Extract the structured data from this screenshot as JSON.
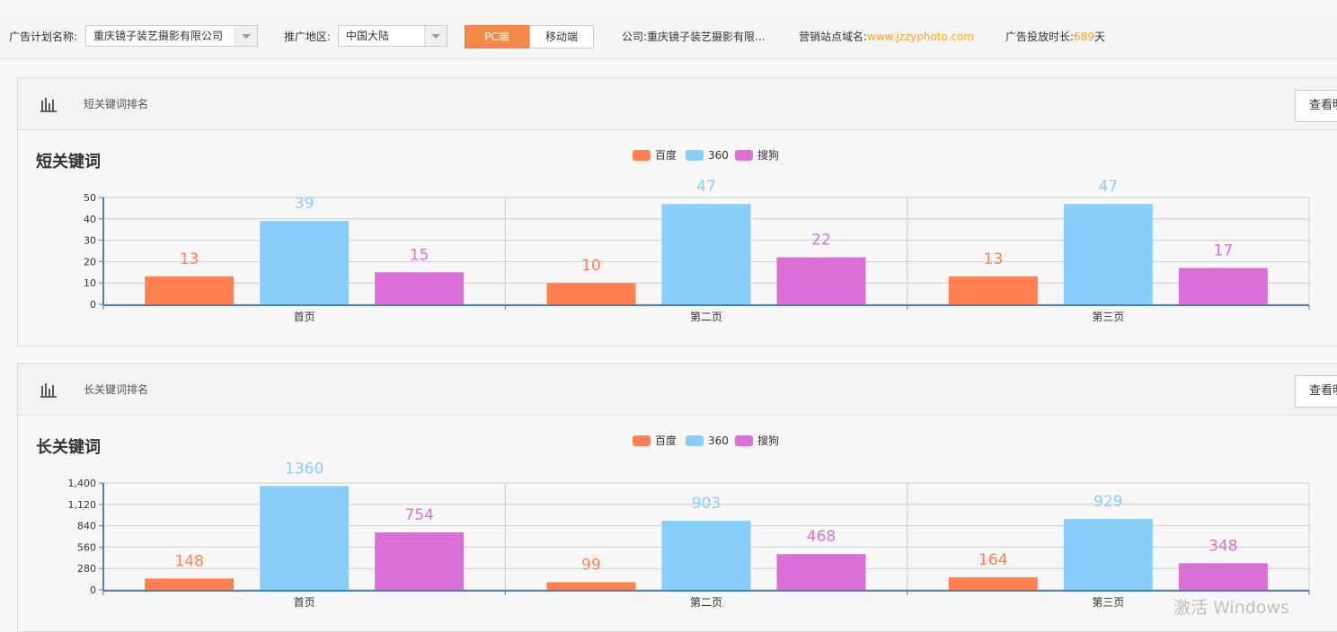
{
  "topbar": {
    "plan_label": "广告计划名称:",
    "plan_value": "重庆镜子装艺摄影有限公司",
    "region_label": "推广地区:",
    "region_value": "中国大陆",
    "pc_label": "PC端",
    "mobile_label": "移动端",
    "company_label": "公司:",
    "company_value": "重庆镜子装艺摄影有限...",
    "domain_label": "营销站点域名:",
    "domain_value": "www.jzzyphoto.com",
    "duration_label": "广告投放时长:",
    "duration_value": "689",
    "duration_unit": "天"
  },
  "panels": [
    {
      "header_title": "短关键词排名",
      "view_button": "查看明细",
      "chart_title": "短关键词"
    },
    {
      "header_title": "长关键词排名",
      "view_button": "查看明细",
      "chart_title": "长关键词"
    }
  ],
  "colors": {
    "baidu": "#ff7f50",
    "s360": "#87cefa",
    "sogou": "#da70d6",
    "accent": "#f5894a",
    "domain": "#f5a623"
  },
  "chart_data": [
    {
      "type": "bar",
      "categories": [
        "首页",
        "第二页",
        "第三页"
      ],
      "series": [
        {
          "name": "百度",
          "values": [
            13,
            10,
            13
          ]
        },
        {
          "name": "360",
          "values": [
            39,
            47,
            47
          ]
        },
        {
          "name": "搜狗",
          "values": [
            15,
            22,
            17
          ]
        }
      ],
      "ylim": [
        0,
        50
      ],
      "yticks": [
        0,
        10,
        20,
        30,
        40,
        50
      ],
      "ytick_labels": [
        "0",
        "10",
        "20",
        "30",
        "40",
        "50"
      ],
      "grid": true,
      "legend": "top-center"
    },
    {
      "type": "bar",
      "categories": [
        "首页",
        "第二页",
        "第三页"
      ],
      "series": [
        {
          "name": "百度",
          "values": [
            148,
            99,
            164
          ]
        },
        {
          "name": "360",
          "values": [
            1360,
            903,
            929
          ]
        },
        {
          "name": "搜狗",
          "values": [
            754,
            468,
            348
          ]
        }
      ],
      "ylim": [
        0,
        1400
      ],
      "yticks": [
        0,
        280,
        560,
        840,
        1120,
        1400
      ],
      "ytick_labels": [
        "0",
        "280",
        "560",
        "840",
        "1,120",
        "1,400"
      ],
      "grid": true,
      "legend": "top-center"
    }
  ],
  "watermark": "激活 Windows"
}
